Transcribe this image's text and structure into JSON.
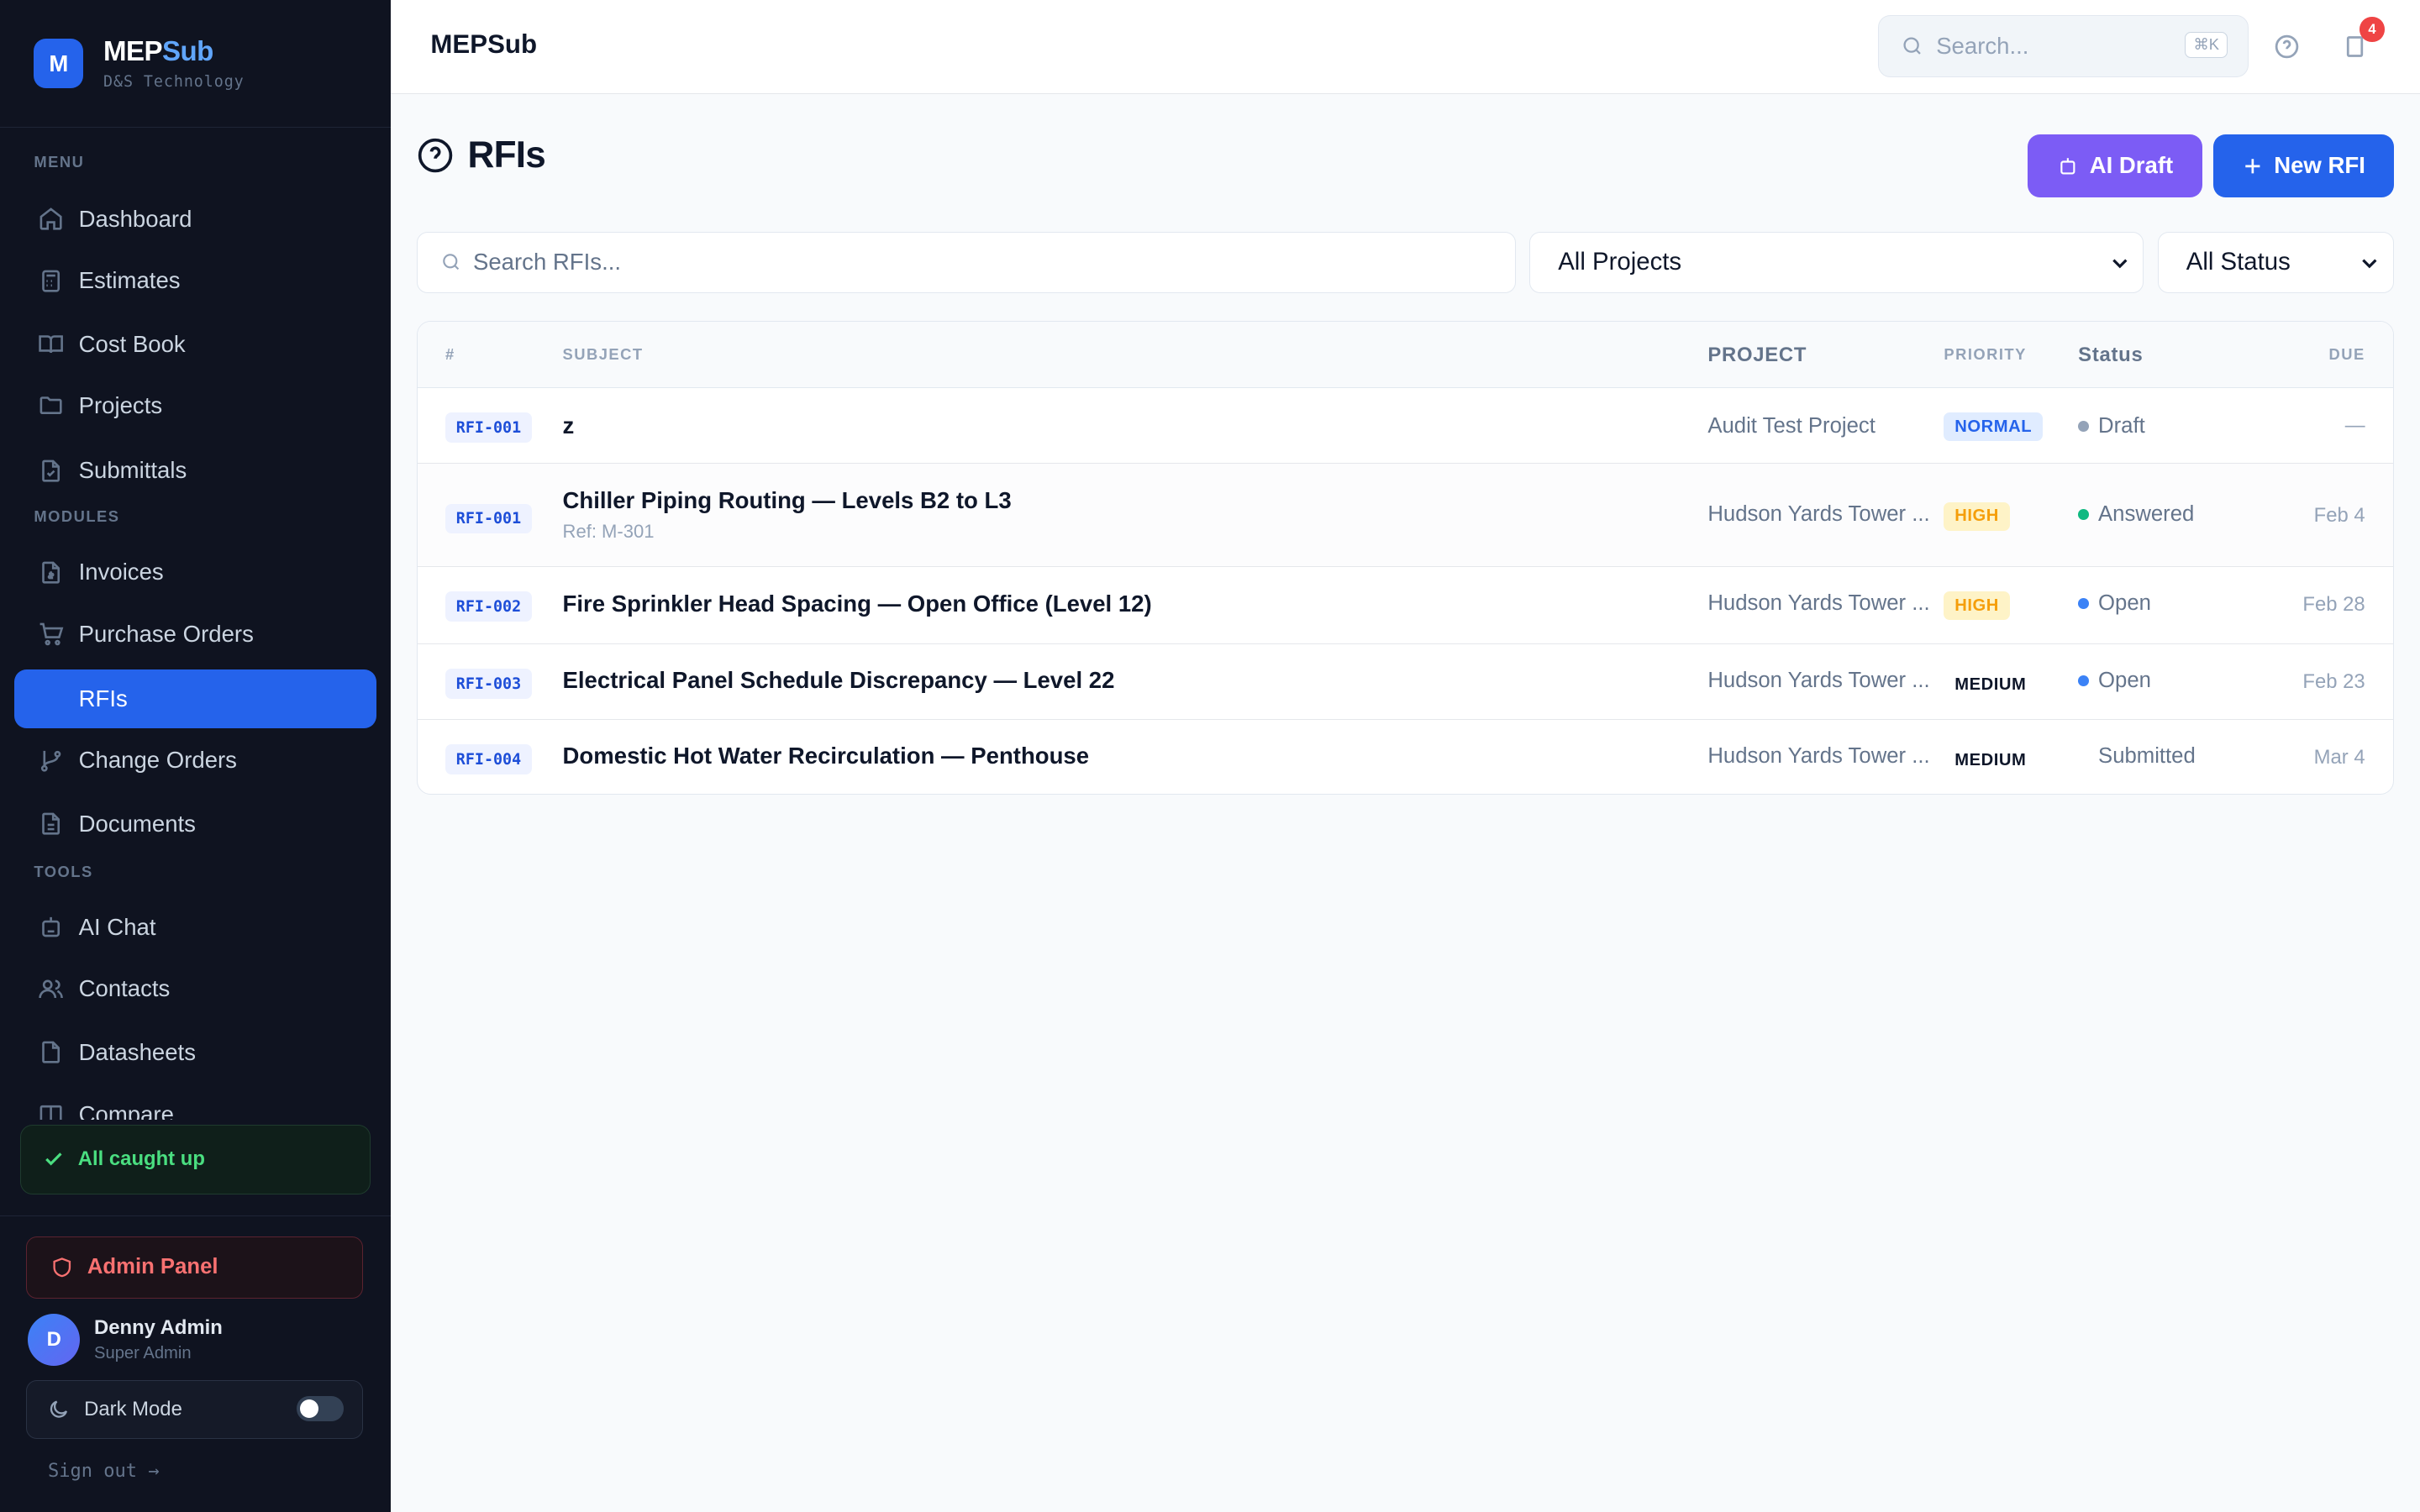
{
  "brand": {
    "logo_letter": "M",
    "name_a": "MEP",
    "name_b": "Sub",
    "org": "D&S Technology"
  },
  "sidebar": {
    "sections": {
      "menu": "MENU",
      "modules": "MODULES",
      "tools": "TOOLS"
    },
    "items": [
      {
        "label": "Dashboard",
        "icon": "home-icon"
      },
      {
        "label": "Estimates",
        "icon": "calculator-icon"
      },
      {
        "label": "Cost Book",
        "icon": "book-icon"
      },
      {
        "label": "Projects",
        "icon": "folder-icon"
      },
      {
        "label": "Submittals",
        "icon": "file-check-icon"
      },
      {
        "label": "Invoices",
        "icon": "invoice-icon"
      },
      {
        "label": "Purchase Orders",
        "icon": "cart-icon"
      },
      {
        "label": "RFIs",
        "icon": "question-icon",
        "active": true
      },
      {
        "label": "Change Orders",
        "icon": "git-branch-icon"
      },
      {
        "label": "Documents",
        "icon": "document-icon"
      },
      {
        "label": "AI Chat",
        "icon": "bot-icon"
      },
      {
        "label": "Contacts",
        "icon": "users-icon"
      },
      {
        "label": "Datasheets",
        "icon": "file-icon"
      },
      {
        "label": "Compare",
        "icon": "columns-icon"
      }
    ],
    "caught_up": "All caught up",
    "admin_panel": "Admin Panel",
    "user": {
      "initial": "D",
      "name": "Denny Admin",
      "role": "Super Admin"
    },
    "dark_mode": "Dark Mode",
    "sign_out": "Sign out →"
  },
  "topbar": {
    "title": "MEPSub",
    "search_placeholder": "Search...",
    "shortcut": "⌘K",
    "notification_count": "4"
  },
  "page": {
    "title": "RFIs",
    "ai_draft": "AI Draft",
    "new_rfi": "New RFI",
    "search_placeholder": "Search RFIs...",
    "project_filter": "All Projects",
    "status_filter": "All Status"
  },
  "table": {
    "headers": {
      "num": "#",
      "subject": "SUBJECT",
      "project": "PROJECT",
      "priority": "PRIORITY",
      "status": "Status",
      "due": "DUE"
    },
    "rows": [
      {
        "id": "RFI-001",
        "subject": "z",
        "ref": "",
        "project": "Audit Test Project",
        "priority": "NORMAL",
        "status": "Draft",
        "due": "—"
      },
      {
        "id": "RFI-001",
        "subject": "Chiller Piping Routing — Levels B2 to L3",
        "ref": "Ref: M-301",
        "project": "Hudson Yards Tower ...",
        "priority": "HIGH",
        "status": "Answered",
        "due": "Feb 4"
      },
      {
        "id": "RFI-002",
        "subject": "Fire Sprinkler Head Spacing — Open Office (Level 12)",
        "ref": "",
        "project": "Hudson Yards Tower ...",
        "priority": "HIGH",
        "status": "Open",
        "due": "Feb 28"
      },
      {
        "id": "RFI-003",
        "subject": "Electrical Panel Schedule Discrepancy — Level 22",
        "ref": "",
        "project": "Hudson Yards Tower ...",
        "priority": "MEDIUM",
        "status": "Open",
        "due": "Feb 23"
      },
      {
        "id": "RFI-004",
        "subject": "Domestic Hot Water Recirculation — Penthouse",
        "ref": "",
        "project": "Hudson Yards Tower ...",
        "priority": "MEDIUM",
        "status": "Submitted",
        "due": "Mar 4"
      }
    ]
  },
  "colors": {
    "accent": "#2563eb",
    "ai": "#7c5cf5",
    "sidebar_bg": "#0f1320",
    "status_draft": "#94a3b8",
    "status_answered": "#10b981",
    "status_open": "#3b82f6"
  }
}
